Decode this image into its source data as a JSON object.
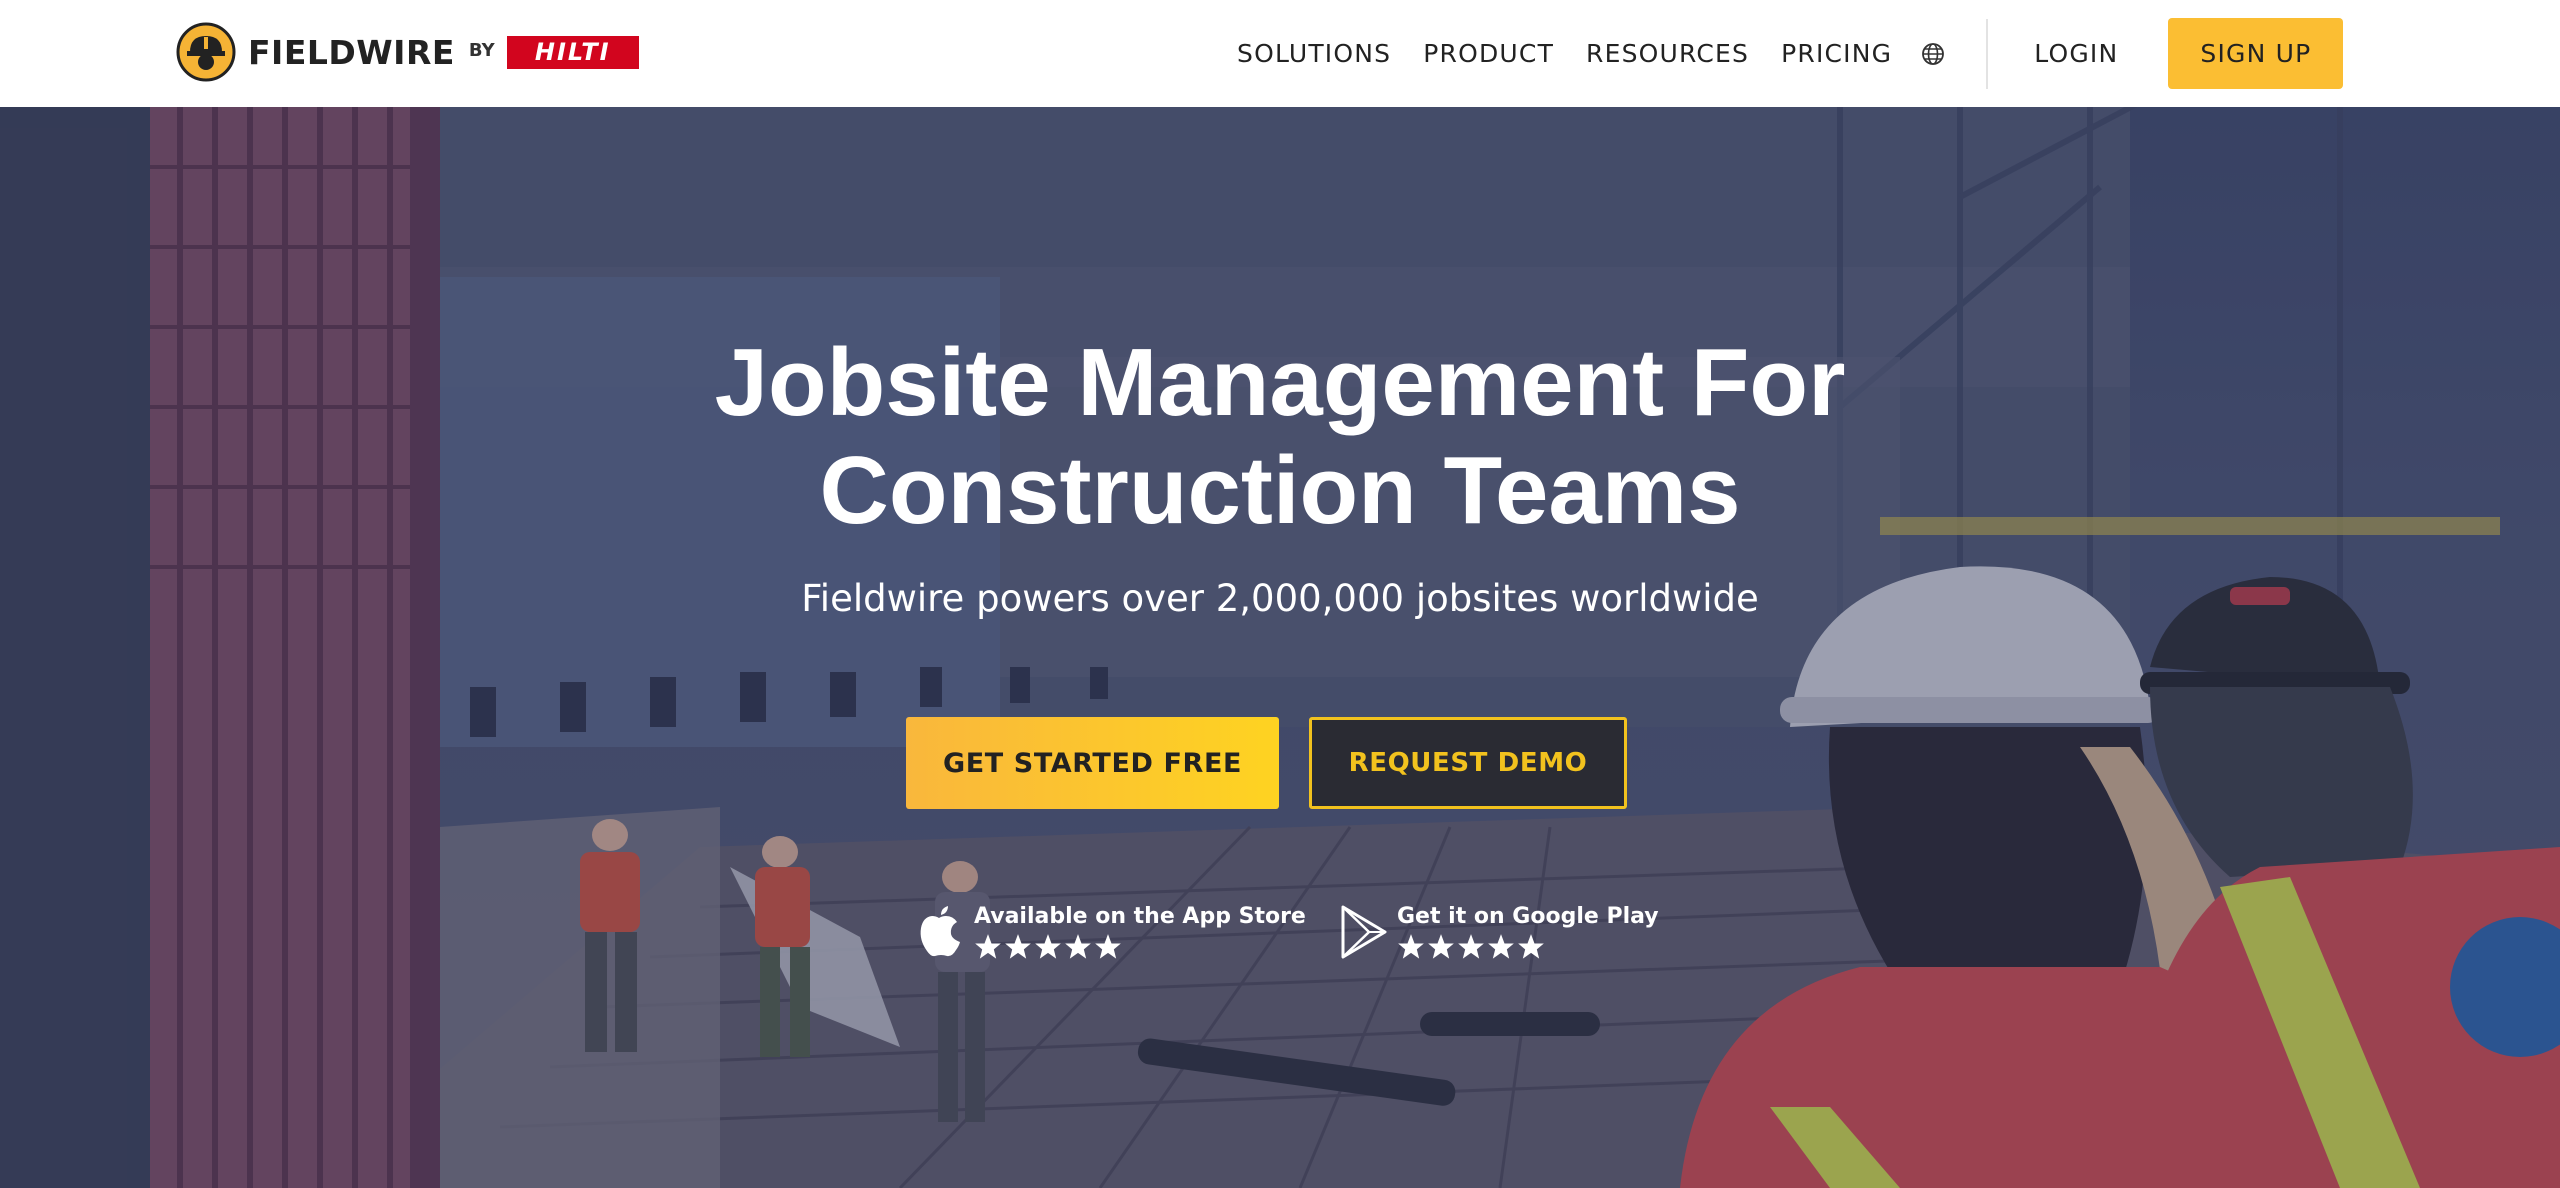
{
  "header": {
    "brand_name": "FIELDWIRE",
    "brand_by": "BY",
    "brand_partner": "HILTI",
    "nav": [
      {
        "label": "SOLUTIONS"
      },
      {
        "label": "PRODUCT"
      },
      {
        "label": "RESOURCES"
      },
      {
        "label": "PRICING"
      }
    ],
    "language_icon": "globe-icon",
    "login_label": "LOGIN",
    "signup_label": "SIGN UP"
  },
  "hero": {
    "headline_line1": "Jobsite Management For",
    "headline_line2": "Construction Teams",
    "subhead": "Fieldwire powers over 2,000,000 jobsites worldwide",
    "primary_cta": "GET STARTED FREE",
    "secondary_cta": "REQUEST DEMO",
    "app_store": {
      "label": "Available on the App Store",
      "icon": "apple-icon",
      "rating_stars": 5
    },
    "google_play": {
      "label": "Get it on Google Play",
      "icon": "google-play-icon",
      "rating_stars": 5
    }
  },
  "colors": {
    "accent": "#fbbe33",
    "accent_gradient_end": "#fed321",
    "secondary_button_bg": "#2a2b33",
    "secondary_button_border": "#f2c21e",
    "hilti_red": "#d2051e"
  }
}
